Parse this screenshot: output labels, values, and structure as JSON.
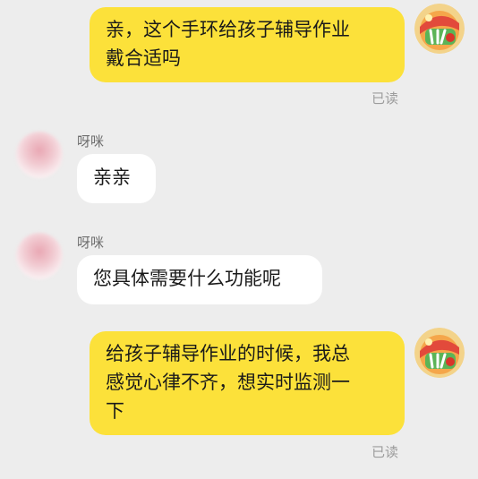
{
  "messages": [
    {
      "id": "m1",
      "from": "me",
      "lines": [
        "亲，这个手环给孩子辅导作业",
        "戴合适吗"
      ],
      "status": "已读"
    },
    {
      "id": "m2",
      "from": "other",
      "sender": "呀咪",
      "text": "亲亲"
    },
    {
      "id": "m3",
      "from": "other",
      "sender": "呀咪",
      "text": "您具体需要什么功能呢"
    },
    {
      "id": "m4",
      "from": "me",
      "lines": [
        "给孩子辅导作业的时候，我总",
        "感觉心律不齐，想实时监测一",
        "下"
      ],
      "status": "已读"
    }
  ],
  "colors": {
    "background": "#ededed",
    "outgoing_bubble": "#fce13a",
    "incoming_bubble": "#ffffff",
    "read_status": "#9c9c9c"
  },
  "icons": {
    "self_avatar": "cartoon-avatar-icon",
    "other_avatar": "blurred-avatar"
  }
}
